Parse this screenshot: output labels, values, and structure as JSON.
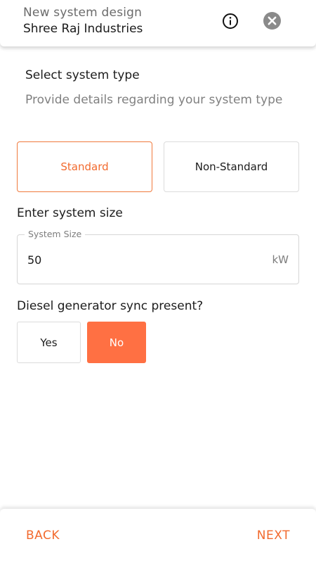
{
  "header": {
    "subtitle": "New system design",
    "title": "Shree Raj Industries",
    "info_icon": "info-circle-icon",
    "close_icon": "close-circle-icon"
  },
  "system_type": {
    "heading": "Select system type",
    "description": "Provide details regarding your system type",
    "options": [
      {
        "label": "Standard",
        "selected": true
      },
      {
        "label": "Non-Standard",
        "selected": false
      }
    ]
  },
  "system_size": {
    "heading": "Enter system size",
    "field_label": "System Size",
    "value": "50",
    "unit": "kW"
  },
  "diesel_sync": {
    "heading": "Diesel generator sync present?",
    "options": [
      {
        "label": "Yes",
        "selected": false
      },
      {
        "label": "No",
        "selected": true
      }
    ]
  },
  "footer": {
    "back_label": "BACK",
    "next_label": "NEXT"
  },
  "colors": {
    "accent": "#f26a2e",
    "selected_fill": "#ff7043"
  }
}
